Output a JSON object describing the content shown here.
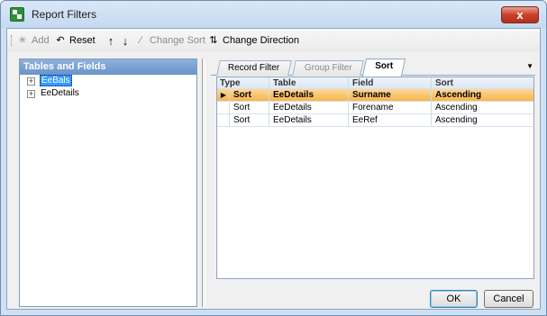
{
  "window": {
    "title": "Report Filters",
    "close_glyph": "x"
  },
  "toolbar": {
    "add": {
      "label": "Add",
      "icon": "add-icon",
      "enabled": false
    },
    "reset": {
      "label": "Reset",
      "icon": "reset-icon",
      "enabled": true
    },
    "move_up": {
      "icon": "arrow-up-icon",
      "enabled": true
    },
    "move_down": {
      "icon": "arrow-down-icon",
      "enabled": true
    },
    "change_sort": {
      "label": "Change Sort",
      "icon": "change-sort-icon",
      "enabled": false
    },
    "change_direction": {
      "label": "Change Direction",
      "icon": "change-direction-icon",
      "enabled": true
    }
  },
  "tree": {
    "header": "Tables and Fields",
    "items": [
      {
        "label": "EeBals",
        "toggle": "+",
        "selected": true
      },
      {
        "label": "EeDetails",
        "toggle": "+",
        "selected": false
      }
    ]
  },
  "tabs": [
    {
      "label": "Record Filter",
      "state": "normal"
    },
    {
      "label": "Group Filter",
      "state": "disabled"
    },
    {
      "label": "Sort",
      "state": "active"
    }
  ],
  "grid": {
    "columns": [
      "Type",
      "Table",
      "Field",
      "Sort"
    ],
    "rows": [
      {
        "type": "Sort",
        "table": "EeDetails",
        "field": "Surname",
        "sort": "Ascending",
        "selected": true
      },
      {
        "type": "Sort",
        "table": "EeDetails",
        "field": "Forename",
        "sort": "Ascending",
        "selected": false
      },
      {
        "type": "Sort",
        "table": "EeDetails",
        "field": "EeRef",
        "sort": "Ascending",
        "selected": false
      }
    ]
  },
  "buttons": {
    "ok": "OK",
    "cancel": "Cancel"
  },
  "colors": {
    "selected_row": "#f9b44a",
    "panel_header": "#6a93ca",
    "tree_selection": "#3399ff"
  }
}
